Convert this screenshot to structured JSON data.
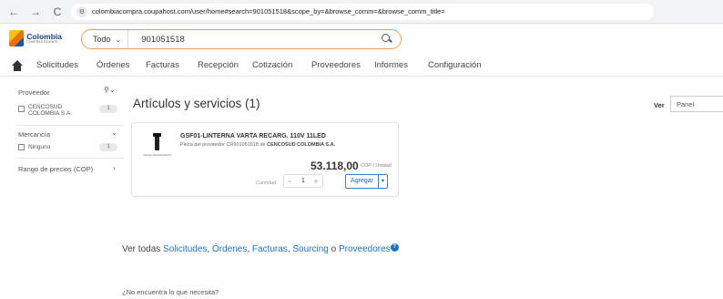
{
  "browser": {
    "back_icon": "←",
    "forward_icon": "→",
    "reload_icon": "C",
    "site_icon": "⚙",
    "url": "colombiacompra.coupahost.com/user/home#search=901051518&scope_by=&browse_comm=&browse_comm_title="
  },
  "header": {
    "logo_name": "Colombia",
    "logo_sub": "COMPRA EFICIENTE",
    "search_scope": "Todo",
    "search_value": "901051518"
  },
  "nav": {
    "items": [
      "Solicitudes",
      "Órdenes",
      "Facturas",
      "Recepción",
      "Cotización",
      "Proveedores",
      "Informes",
      "Configuración"
    ]
  },
  "sidebar": {
    "proveedor": {
      "title": "Proveedor",
      "option_label_line1": "CENCOSUD",
      "option_label_line2": "COLOMBIA S.A.",
      "option_count": "1"
    },
    "mercancia": {
      "title": "Mercancía",
      "option_label": "Ninguno",
      "option_count": "1"
    },
    "rango": {
      "title": "Rango de precios (COP)"
    }
  },
  "results": {
    "title": "Artículos y servicios (1)",
    "view_label": "Ver",
    "view_value": "Panel"
  },
  "item": {
    "thumb_caption": "IMAGEN DE REFERENCIA",
    "title": "GSF01-LINTERNA VARTA RECARG. 110V 11LED",
    "sub_prefix": "Pieza del proveedor CR901051518 de",
    "sub_supplier": "CENCOSUD COLOMBIA S.A.",
    "price": "53.118,00",
    "price_unit": "COP / Unidad",
    "qty_label": "Cantidad",
    "qty_value": "1",
    "minus": "−",
    "plus": "+",
    "add_label": "Agregar",
    "add_drop": "▾"
  },
  "footer_links": {
    "prefix": "Ver todas",
    "solicitudes": "Solicitudes",
    "ordenes": "Órdenes",
    "facturas": "Facturas",
    "sourcing": "Sourcing",
    "connector": "o",
    "proveedores": "Proveedores",
    "help": "?",
    "not_found": "¿No encuentra lo que necesita?"
  }
}
